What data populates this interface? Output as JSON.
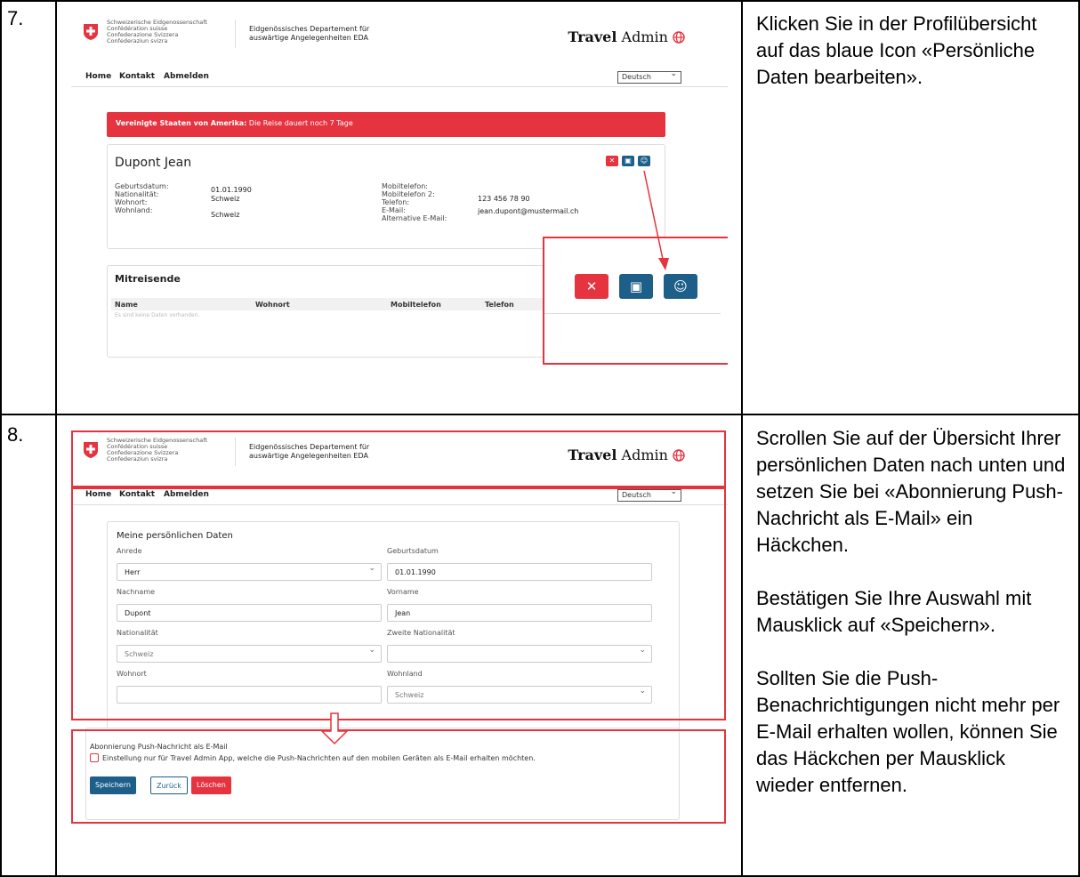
{
  "steps": [
    {
      "number": "7.",
      "instruction": "Klicken Sie in der Profilübersicht auf das blaue Icon «Persönliche Daten bearbeiten»."
    },
    {
      "number": "8.",
      "instruction_paragraphs": [
        "Scrollen Sie auf der Übersicht Ihrer persönlichen Daten nach unten und setzen Sie bei «Abonnierung Push-Nachricht als E-Mail» ein Häckchen.",
        "Bestätigen Sie Ihre Auswahl mit Mausklick auf «Speichern».",
        "Sollten Sie die Push-Benachrichtigungen nicht mehr per E-Mail erhalten wollen, können Sie das Häckchen per Mausklick wieder entfernen."
      ]
    }
  ],
  "header": {
    "confed_lines": [
      "Schweizerische Eidgenossenschaft",
      "Confédération suisse",
      "Confederazione Svizzera",
      "Confederaziun svizra"
    ],
    "dept_line1": "Eidgenössisches Departement für",
    "dept_line2": "auswärtige Angelegenheiten EDA",
    "brand_bold": "Travel",
    "brand_rest": "Admin"
  },
  "nav": {
    "home": "Home",
    "contact": "Kontakt",
    "logout": "Abmelden",
    "language": "Deutsch"
  },
  "profile": {
    "alert_country": "Vereinigte Staaten von Amerika:",
    "alert_text": "Die Reise dauert noch 7 Tage",
    "name": "Dupont Jean",
    "labels_left": [
      "Geburtsdatum:",
      "Nationalität:",
      "Wohnort:",
      "Wohnland:"
    ],
    "values_left": [
      "01.01.1990",
      "Schweiz",
      "",
      "Schweiz"
    ],
    "labels_right": [
      "Mobiltelefon:",
      "Mobiltelefon 2:",
      "Telefon:",
      "E-Mail:",
      "Alternative E-Mail:"
    ],
    "phone": "123 456 78 90",
    "email": "jean.dupont@mustermail.ch",
    "companions_title": "Mitreisende",
    "companions_cols": [
      "Name",
      "Wohnort",
      "Mobiltelefon",
      "Telefon"
    ],
    "companions_empty": "Es sind keine Daten vorhanden."
  },
  "form": {
    "title": "Meine persönlichen Daten",
    "salutation_label": "Anrede",
    "salutation": "Herr",
    "birthdate_label": "Geburtsdatum",
    "birthdate": "01.01.1990",
    "lastname_label": "Nachname",
    "lastname": "Dupont",
    "firstname_label": "Vorname",
    "firstname": "Jean",
    "nationality_label": "Nationalität",
    "nationality": "Schweiz",
    "nationality2_label": "Zweite Nationalität",
    "nationality2": "",
    "residence_label": "Wohnort",
    "residence": "",
    "country_label": "Wohnland",
    "country": "Schweiz",
    "push_title": "Abonnierung Push-Nachricht als E-Mail",
    "push_text": "Einstellung nur für Travel Admin App, welche die Push-Nachrichten auf den mobilen Geräten als E-Mail erhalten möchten.",
    "save": "Speichern",
    "back": "Zurück",
    "delete": "Löschen"
  },
  "colors": {
    "red": "#e5333f",
    "blue": "#1e5f8a"
  }
}
